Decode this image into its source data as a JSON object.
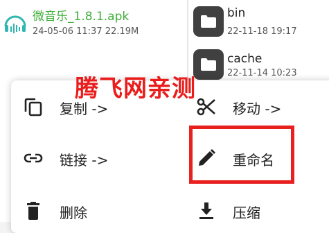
{
  "left_pane": {
    "file": {
      "name": "微音乐_1.8.1.apk",
      "date": "24-05-06 11:37",
      "size": "22.19M",
      "icon": "music-app-icon"
    }
  },
  "right_pane": {
    "folders": [
      {
        "name": "bin",
        "date": "22-11-18 19:17",
        "icon": "folder-icon"
      },
      {
        "name": "cache",
        "date": "22-11-14 10:23",
        "icon": "folder-icon"
      }
    ]
  },
  "context_menu": {
    "items": [
      {
        "label": "复制 ->",
        "icon": "copy-icon"
      },
      {
        "label": "移动 ->",
        "icon": "scissors-icon"
      },
      {
        "label": "链接 ->",
        "icon": "link-icon"
      },
      {
        "label": "重命名",
        "icon": "pencil-icon"
      },
      {
        "label": "删除",
        "icon": "trash-icon"
      },
      {
        "label": "压缩",
        "icon": "download-icon"
      }
    ]
  },
  "watermark": "腾飞网亲测",
  "colors": {
    "file_name": "#3fae3a",
    "watermark": "#ea1c1c",
    "highlight": "#e82020",
    "icon": "#404040"
  }
}
